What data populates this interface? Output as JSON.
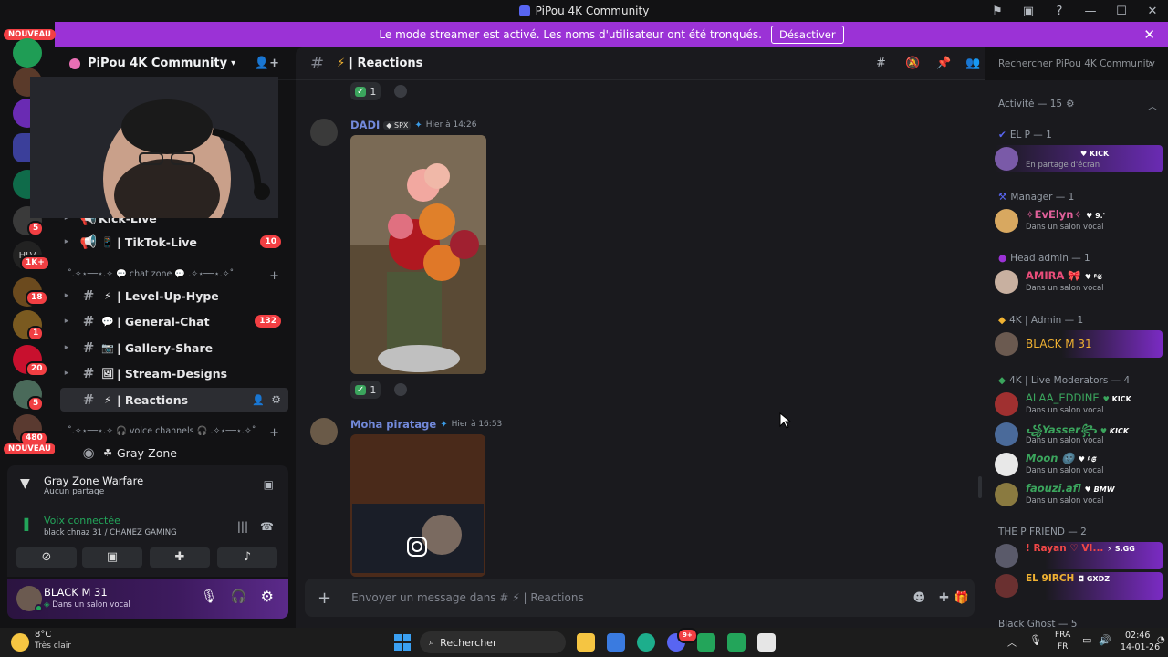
{
  "window": {
    "title": "PiPou 4K Community"
  },
  "banner": {
    "text": "Le mode streamer est activé. Les noms d'utilisateur ont été tronqués.",
    "button": "Désactiver"
  },
  "guilds": {
    "nouveau": "NOUVEAU",
    "badges": [
      "5",
      "1K+",
      "18",
      "1",
      "20",
      "5",
      "480"
    ]
  },
  "server": {
    "name": "PiPou 4K Community"
  },
  "channels": {
    "partial": "Kick-Live",
    "partial_count": "",
    "tiktok": {
      "label": "| TikTok-Live",
      "count": "10",
      "emoji": "📱"
    },
    "cat_chat": "˚.✧⋆──⋆.✧ 💬 chat zone 💬 .✧⋆──⋆.✧˚",
    "items": [
      {
        "label": "| Level-Up-Hype",
        "emoji": "⚡",
        "count": ""
      },
      {
        "label": "| General-Chat",
        "emoji": "💬",
        "count": "132"
      },
      {
        "label": "| Gallery-Share",
        "emoji": "📷",
        "count": ""
      },
      {
        "label": "| Stream-Designs",
        "emoji": "🖼",
        "count": ""
      },
      {
        "label": "| Reactions",
        "emoji": "⚡",
        "count": ""
      }
    ],
    "cat_voice": "˚.✧⋆──⋆.✧ 🎧 voice channels 🎧 .✧⋆──⋆.✧˚",
    "voice": {
      "label": "Gray-Zone"
    }
  },
  "activity": {
    "game": "Gray Zone Warfare",
    "sub": "Aucun partage"
  },
  "voice": {
    "status": "Voix connectée",
    "channel": "black chnaz 31 / CHANEZ GAMING"
  },
  "user": {
    "name": "BLACK M 31",
    "status": "Dans un salon vocal"
  },
  "header": {
    "channel": "| Reactions",
    "search_placeholder": "Rechercher PiPou 4K Community"
  },
  "messages": [
    {
      "author": "DADI",
      "tag": "SPX",
      "time": "Hier à 14:26",
      "reaction_count": "1"
    },
    {
      "author": "Moha piratage",
      "time": "Hier à 16:53"
    }
  ],
  "top_reaction": "1",
  "composer": {
    "placeholder": "Envoyer un message dans # ⚡ | Reactions"
  },
  "members": {
    "activity_title": "Activité — 15",
    "groups": [
      {
        "title": "EL P — 1"
      },
      {
        "title": "Manager — 1"
      },
      {
        "title": "Head admin — 1"
      },
      {
        "title": "4K | Admin — 1"
      },
      {
        "title": "4K | Live Moderators — 4"
      },
      {
        "title": "THE P FRIEND — 2"
      },
      {
        "title": "Black Ghost — 5"
      }
    ],
    "list": [
      {
        "name": "",
        "tag": "KICK",
        "status": "En partage d'écran",
        "color": "#ffffff"
      },
      {
        "name": "✧EvElyn✧",
        "tag": "9.'",
        "status": "Dans un salon vocal",
        "color": "#e0609a"
      },
      {
        "name": "AMIRA 🎀",
        "tag": "ᵝ𝕾",
        "status": "Dans un salon vocal",
        "color": "#e94d7a"
      },
      {
        "name": "BLACK M 31",
        "tag": "",
        "status": "",
        "color": "#f0b232"
      },
      {
        "name": "ALAA_EDDINE",
        "tag": "KICK",
        "status": "Dans un salon vocal",
        "color": "#3ba55d"
      },
      {
        "name": "꧁Yasser꧂",
        "tag": "KICK",
        "status": "Dans un salon vocal",
        "color": "#3ba55d"
      },
      {
        "name": "Moon 🌚",
        "tag": "ᵝ𝕾",
        "status": "Dans un salon vocal",
        "color": "#3ba55d"
      },
      {
        "name": "faouzi.afl",
        "tag": "BMW",
        "status": "Dans un salon vocal",
        "color": "#3ba55d"
      },
      {
        "name": "! Rayan ♡ VI...",
        "tag": "S.GG",
        "status": "",
        "color": "#f04747"
      },
      {
        "name": "EL 9IRCH",
        "tag": "GXDZ",
        "status": "",
        "color": "#f0b232"
      }
    ]
  },
  "taskbar": {
    "temp": "8°C",
    "weather": "Très clair",
    "search": "Rechercher",
    "lang1": "FRA",
    "lang2": "FR",
    "time": "02:46",
    "date": "14-01-26",
    "discord_badge": "9+"
  },
  "colors": {
    "banner": "#9b32d6",
    "accent": "#5865f2"
  }
}
